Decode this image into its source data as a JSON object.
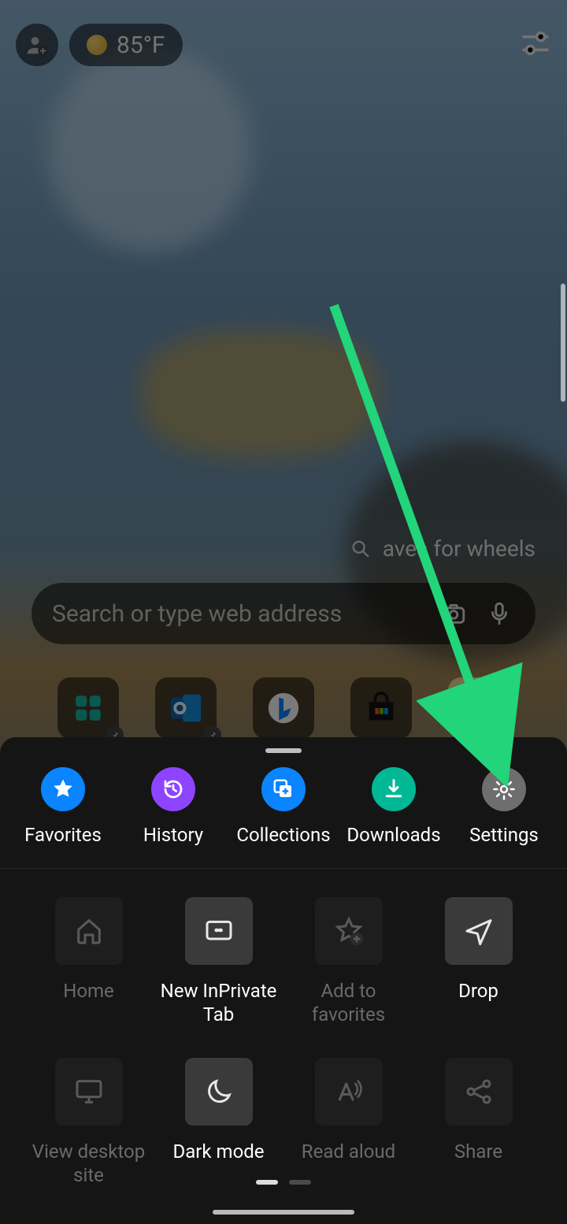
{
  "status": {
    "temperature": "85°F"
  },
  "suggest": "aves for wheels",
  "search": {
    "placeholder": "Search or type web address"
  },
  "primary": [
    {
      "label": "Favorites",
      "name": "favorites-button",
      "icon": "star-icon",
      "color": "#0a84ff"
    },
    {
      "label": "History",
      "name": "history-button",
      "icon": "history-icon",
      "color": "#8e44ff"
    },
    {
      "label": "Collections",
      "name": "collections-button",
      "icon": "collections-icon",
      "color": "#0a84ff"
    },
    {
      "label": "Downloads",
      "name": "downloads-button",
      "icon": "download-icon",
      "color": "#00b894"
    },
    {
      "label": "Settings",
      "name": "settings-button",
      "icon": "gear-icon",
      "color": "#6e6e6e"
    }
  ],
  "actions": [
    {
      "label": "Home",
      "name": "home-action",
      "icon": "home-icon",
      "state": "dim"
    },
    {
      "label": "New InPrivate Tab",
      "name": "new-inprivate-action",
      "icon": "inprivate-icon",
      "state": "lit"
    },
    {
      "label": "Add to favorites",
      "name": "add-favorites-action",
      "icon": "star-plus-icon",
      "state": "dim"
    },
    {
      "label": "Drop",
      "name": "drop-action",
      "icon": "send-icon",
      "state": "lit"
    },
    {
      "label": "View desktop site",
      "name": "desktop-site-action",
      "icon": "desktop-icon",
      "state": "dim"
    },
    {
      "label": "Dark mode",
      "name": "dark-mode-action",
      "icon": "moon-icon",
      "state": "lit"
    },
    {
      "label": "Read aloud",
      "name": "read-aloud-action",
      "icon": "read-aloud-icon",
      "state": "dim"
    },
    {
      "label": "Share",
      "name": "share-action",
      "icon": "share-icon",
      "state": "dim"
    }
  ],
  "page_indicator": {
    "total": 2,
    "active": 0
  }
}
